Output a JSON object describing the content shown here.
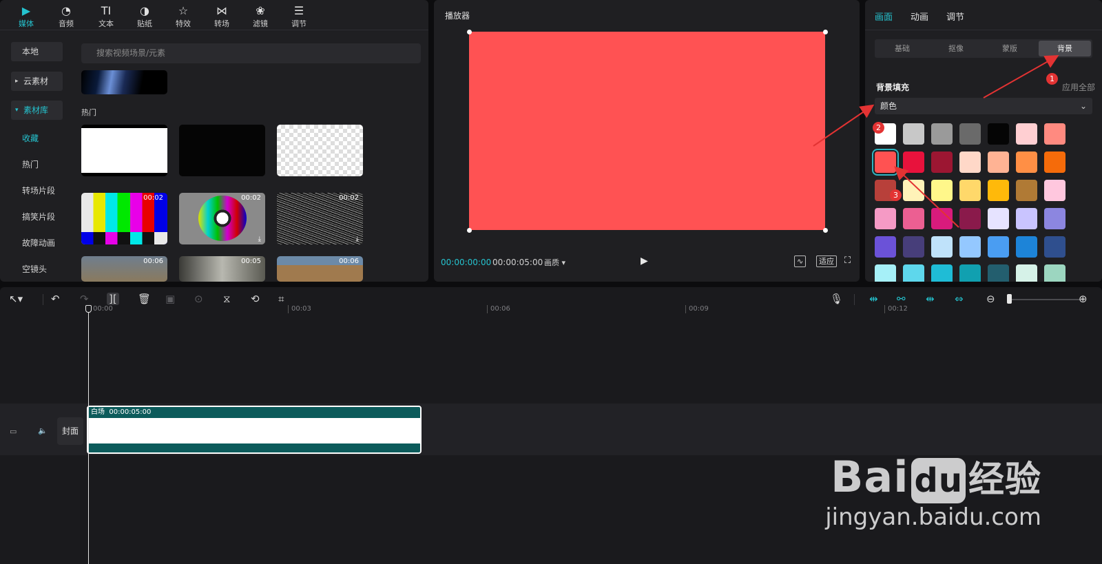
{
  "media_panel": {
    "tabs": [
      {
        "label": "媒体",
        "icon": "media-icon"
      },
      {
        "label": "音频",
        "icon": "audio-icon"
      },
      {
        "label": "文本",
        "icon": "text-icon"
      },
      {
        "label": "贴纸",
        "icon": "sticker-icon"
      },
      {
        "label": "特效",
        "icon": "effects-icon"
      },
      {
        "label": "转场",
        "icon": "transition-icon"
      },
      {
        "label": "滤镜",
        "icon": "filter-icon"
      },
      {
        "label": "调节",
        "icon": "adjust-icon"
      }
    ],
    "sidebar": {
      "local": "本地",
      "cloud": "云素材",
      "library": "素材库",
      "items": [
        "收藏",
        "热门",
        "转场片段",
        "搞笑片段",
        "故障动画",
        "空镜头"
      ]
    },
    "search_placeholder": "搜索视频场景/元素",
    "section_hot": "热门",
    "durations": [
      "00:02",
      "00:02",
      "00:02",
      "00:06",
      "00:05",
      "00:06"
    ]
  },
  "player": {
    "title": "播放器",
    "timecode_current": "00:00:00:00",
    "timecode_total": "00:00:05:00",
    "quality": "画质",
    "fit_label": "适应",
    "canvas_color": "#ff5253"
  },
  "props": {
    "tabs": [
      "画面",
      "动画",
      "调节"
    ],
    "subtabs": [
      "基础",
      "抠像",
      "蒙版",
      "背景"
    ],
    "section_title": "背景填充",
    "apply_all": "应用全部",
    "fill_type": "颜色",
    "swatches": [
      "#ffffff",
      "#c8c8c8",
      "#9a9a9a",
      "#6a6a6a",
      "#050505",
      "#ffcfd2",
      "#ff8a80",
      "#ff5252",
      "#e8123c",
      "#9c1632",
      "#ffd8c8",
      "#ffb394",
      "#ff8f45",
      "#f56b0a",
      "#b8403a",
      "#fff2b8",
      "#fff78a",
      "#ffd86a",
      "#ffb90a",
      "#b07a35",
      "#ffc7de",
      "#f59ac5",
      "#ec5f92",
      "#d81b7c",
      "#8a1a4b",
      "#e6e3ff",
      "#c9c4ff",
      "#8c86e0",
      "#6b52d8",
      "#473e7a",
      "#bfe2fa",
      "#94c8ff",
      "#4a9df2",
      "#1d84d8",
      "#2f4f8e",
      "#a6f0f8",
      "#5ed7ec",
      "#1fbcd6",
      "#11a0b0",
      "#235e6e",
      "#d6f2e8",
      "#9cd6c0"
    ],
    "selected_swatch": 7
  },
  "annotations": [
    "1",
    "2",
    "3"
  ],
  "timeline": {
    "ruler": [
      "00:00",
      "00:03",
      "00:06",
      "00:09",
      "00:12"
    ],
    "clip_name": "白场",
    "clip_duration": "00:00:05:00",
    "cover_label": "封面"
  },
  "watermark": {
    "brand_a": "Bai",
    "brand_b": "du",
    "brand_c": "经验",
    "url": "jingyan.baidu.com"
  }
}
